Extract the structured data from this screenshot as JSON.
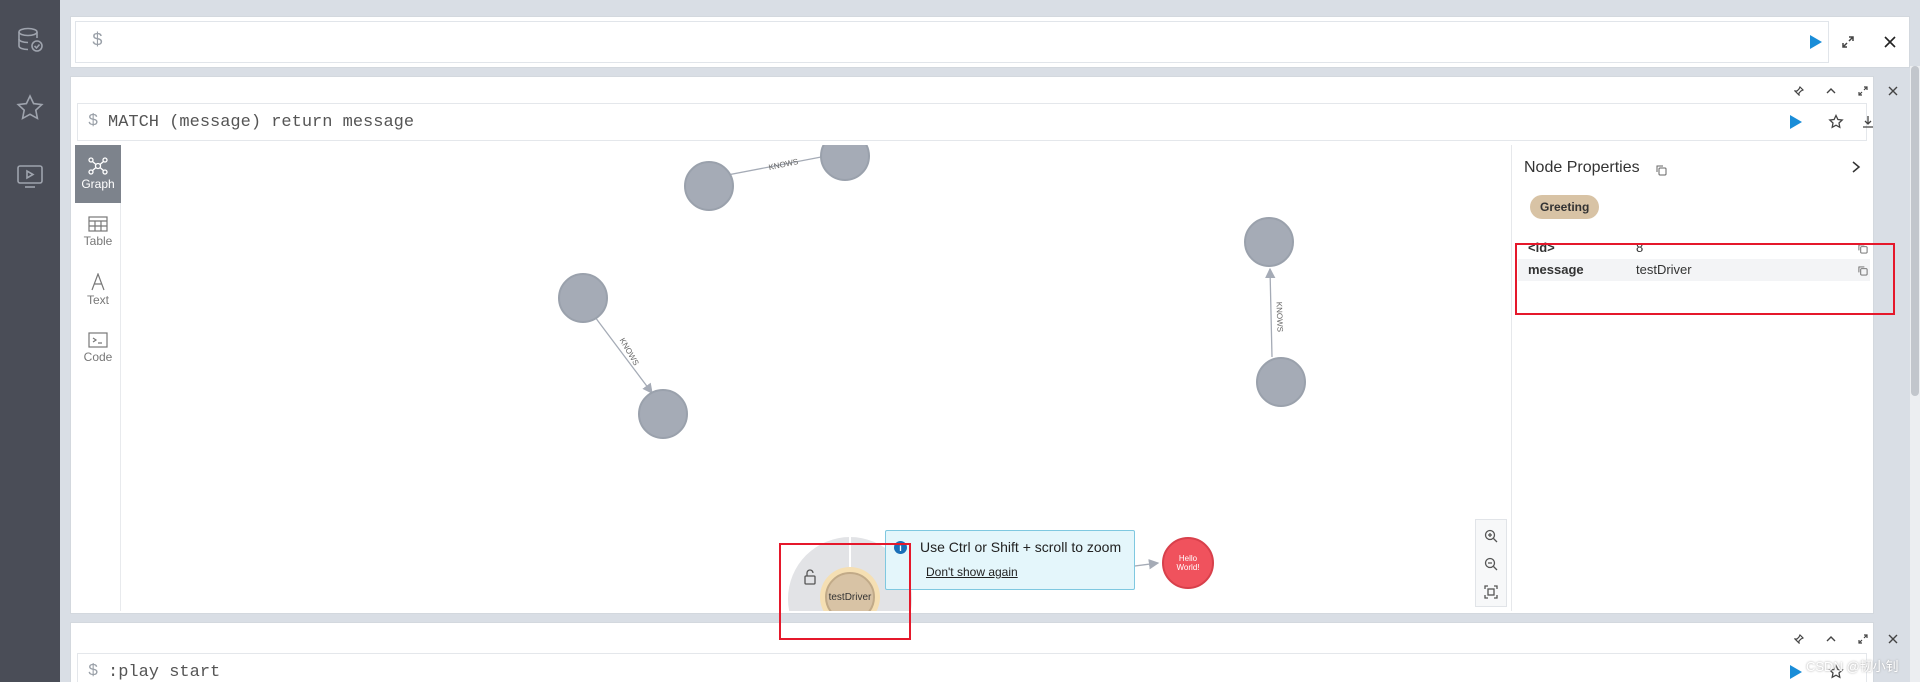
{
  "sidebar": {
    "icons": [
      "database-icon",
      "star-icon",
      "monitor-play-icon"
    ]
  },
  "top_editor": {
    "prompt": "$",
    "value": ""
  },
  "frame": {
    "prompt": "$",
    "query": "MATCH (message) return message"
  },
  "view_tabs": [
    {
      "label": "Graph"
    },
    {
      "label": "Table"
    },
    {
      "label": "Text"
    },
    {
      "label": "Code"
    }
  ],
  "graph": {
    "relationship_label": "KNOWS",
    "selected_node_caption": "testDriver",
    "hello_node_caption_line1": "Hello",
    "hello_node_caption_line2": "World!"
  },
  "tooltip": {
    "message": "Use Ctrl or Shift + scroll to zoom",
    "dismiss": "Don't show again"
  },
  "node_properties": {
    "title": "Node Properties",
    "label_badge": "Greeting",
    "rows": [
      {
        "key": "<id>",
        "value": "8"
      },
      {
        "key": "message",
        "value": "testDriver"
      }
    ]
  },
  "bottom_frame": {
    "prompt": "$",
    "query": ":play start"
  },
  "watermark": "CSDN @韧小钊",
  "colors": {
    "sidebar": "#4a4d57",
    "play_blue": "#1a8dd8",
    "node_gray": "#a5abb6",
    "badge": "#d8c3a5",
    "hello_node": "#f0525d",
    "highlight_red": "#e5182b"
  }
}
